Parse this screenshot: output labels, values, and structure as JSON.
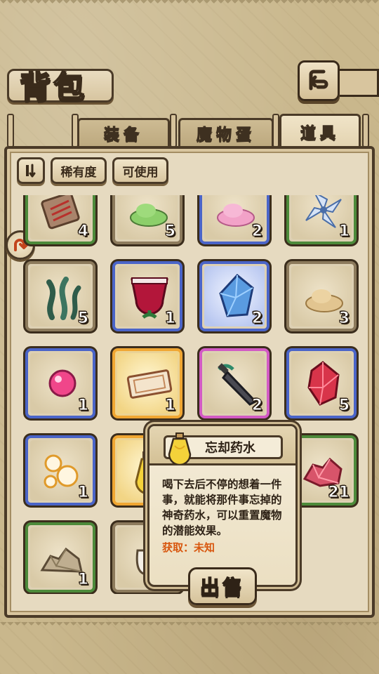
{
  "header": {
    "title": "背包"
  },
  "tabs": [
    {
      "label": "装备",
      "active": false
    },
    {
      "label": "魔物蛋",
      "active": false
    },
    {
      "label": "道具",
      "active": true
    }
  ],
  "filters": {
    "rarity_label": "稀有度",
    "usable_label": "可使用"
  },
  "items": [
    {
      "icon": "parchment-icon",
      "count": "4",
      "frame": "green"
    },
    {
      "icon": "green-slime-icon",
      "count": "5",
      "frame": "brown"
    },
    {
      "icon": "pink-slime-icon",
      "count": "2",
      "frame": "blue"
    },
    {
      "icon": "blue-flower-icon",
      "count": "1",
      "frame": "green"
    },
    {
      "icon": "seaweed-icon",
      "count": "5",
      "frame": "brown"
    },
    {
      "icon": "red-potion-cup-icon",
      "count": "1",
      "frame": "blue"
    },
    {
      "icon": "blue-crystal-icon",
      "count": "2",
      "frame": "blue-glow"
    },
    {
      "icon": "sand-pile-icon",
      "count": "3",
      "frame": "brown"
    },
    {
      "icon": "pink-orb-icon",
      "count": "1",
      "frame": "blue"
    },
    {
      "icon": "ticket-icon",
      "count": "1",
      "frame": "gold"
    },
    {
      "icon": "dark-sword-icon",
      "count": "2",
      "frame": "purple"
    },
    {
      "icon": "red-crystal-icon",
      "count": "5",
      "frame": "blue"
    },
    {
      "icon": "golden-bubbles-icon",
      "count": "1",
      "frame": "blue"
    },
    {
      "icon": "yellow-potion-icon",
      "count": "",
      "frame": "gold"
    },
    {
      "icon": "hidden-slot",
      "count": "",
      "frame": "brown"
    },
    {
      "icon": "red-ore-icon",
      "count": "21",
      "frame": "green"
    },
    {
      "icon": "rock-pile-icon",
      "count": "1",
      "frame": "green"
    },
    {
      "icon": "money-bag-icon",
      "count": "",
      "frame": "brown"
    }
  ],
  "tooltip": {
    "name": "忘却药水",
    "desc_line1": "喝下去后不停的想着一件",
    "desc_line2": "事，就能将那件事忘掉的",
    "desc_line3": "神奇药水，可以重置魔物",
    "desc_line4": "的潜能效果。",
    "source": "获取：未知"
  },
  "sell_label": "出售",
  "colors": {
    "frame_green": "#4c8a3a",
    "frame_blue": "#4a64c8",
    "frame_gold": "#f0a632",
    "frame_purple": "#d25ac4",
    "source_orange": "#d8560e"
  }
}
